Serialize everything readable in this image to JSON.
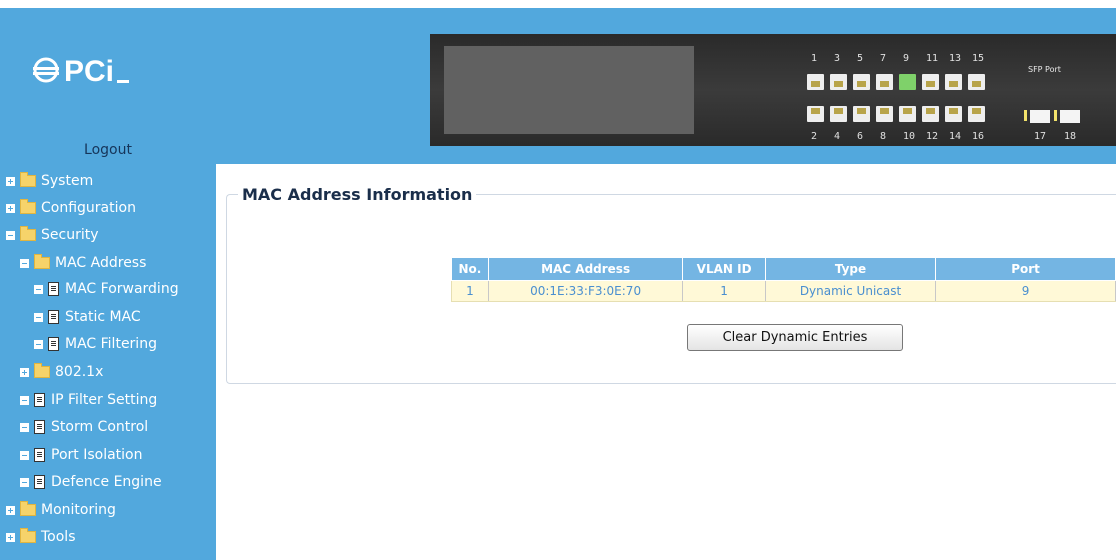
{
  "header": {
    "logo_text": "PCi",
    "logout_label": "Logout",
    "switch_panel": {
      "top_port_numbers": [
        "1",
        "3",
        "5",
        "7",
        "9",
        "11",
        "13",
        "15"
      ],
      "bottom_port_numbers": [
        "2",
        "4",
        "6",
        "8",
        "10",
        "12",
        "14",
        "16"
      ],
      "sfp_label": "SFP Port",
      "sfp_port_numbers": [
        "17",
        "18"
      ],
      "active_port": "9",
      "active_color": "#7fd16a"
    }
  },
  "sidebar": {
    "background": "#52a8dd",
    "items": [
      {
        "label": "System",
        "toggle": "plus",
        "icon": "folder-icon"
      },
      {
        "label": "Configuration",
        "toggle": "plus",
        "icon": "folder-icon"
      },
      {
        "label": "Security",
        "toggle": "minus",
        "icon": "folder-open-icon"
      },
      {
        "label": "MAC Address",
        "toggle": "minus",
        "icon": "folder-open-icon"
      },
      {
        "label": "MAC Forwarding",
        "toggle": "minus",
        "icon": "document-icon"
      },
      {
        "label": "Static MAC",
        "toggle": "minus",
        "icon": "document-icon"
      },
      {
        "label": "MAC Filtering",
        "toggle": "minus",
        "icon": "document-icon"
      },
      {
        "label": "802.1x",
        "toggle": "plus",
        "icon": "folder-icon"
      },
      {
        "label": "IP Filter Setting",
        "toggle": "minus",
        "icon": "document-icon"
      },
      {
        "label": "Storm Control",
        "toggle": "minus",
        "icon": "document-icon"
      },
      {
        "label": "Port Isolation",
        "toggle": "minus",
        "icon": "document-icon"
      },
      {
        "label": "Defence Engine",
        "toggle": "minus",
        "icon": "document-icon"
      },
      {
        "label": "Monitoring",
        "toggle": "plus",
        "icon": "folder-icon"
      },
      {
        "label": "Tools",
        "toggle": "plus",
        "icon": "folder-icon"
      }
    ]
  },
  "main": {
    "section_title": "MAC Address Information",
    "table": {
      "headers": [
        "No.",
        "MAC Address",
        "VLAN ID",
        "Type",
        "Port"
      ],
      "rows": [
        {
          "no": "1",
          "mac": "00:1E:33:F3:0E:70",
          "vlan": "1",
          "type": "Dynamic Unicast",
          "port": "9"
        }
      ]
    },
    "clear_button": "Clear Dynamic Entries"
  }
}
